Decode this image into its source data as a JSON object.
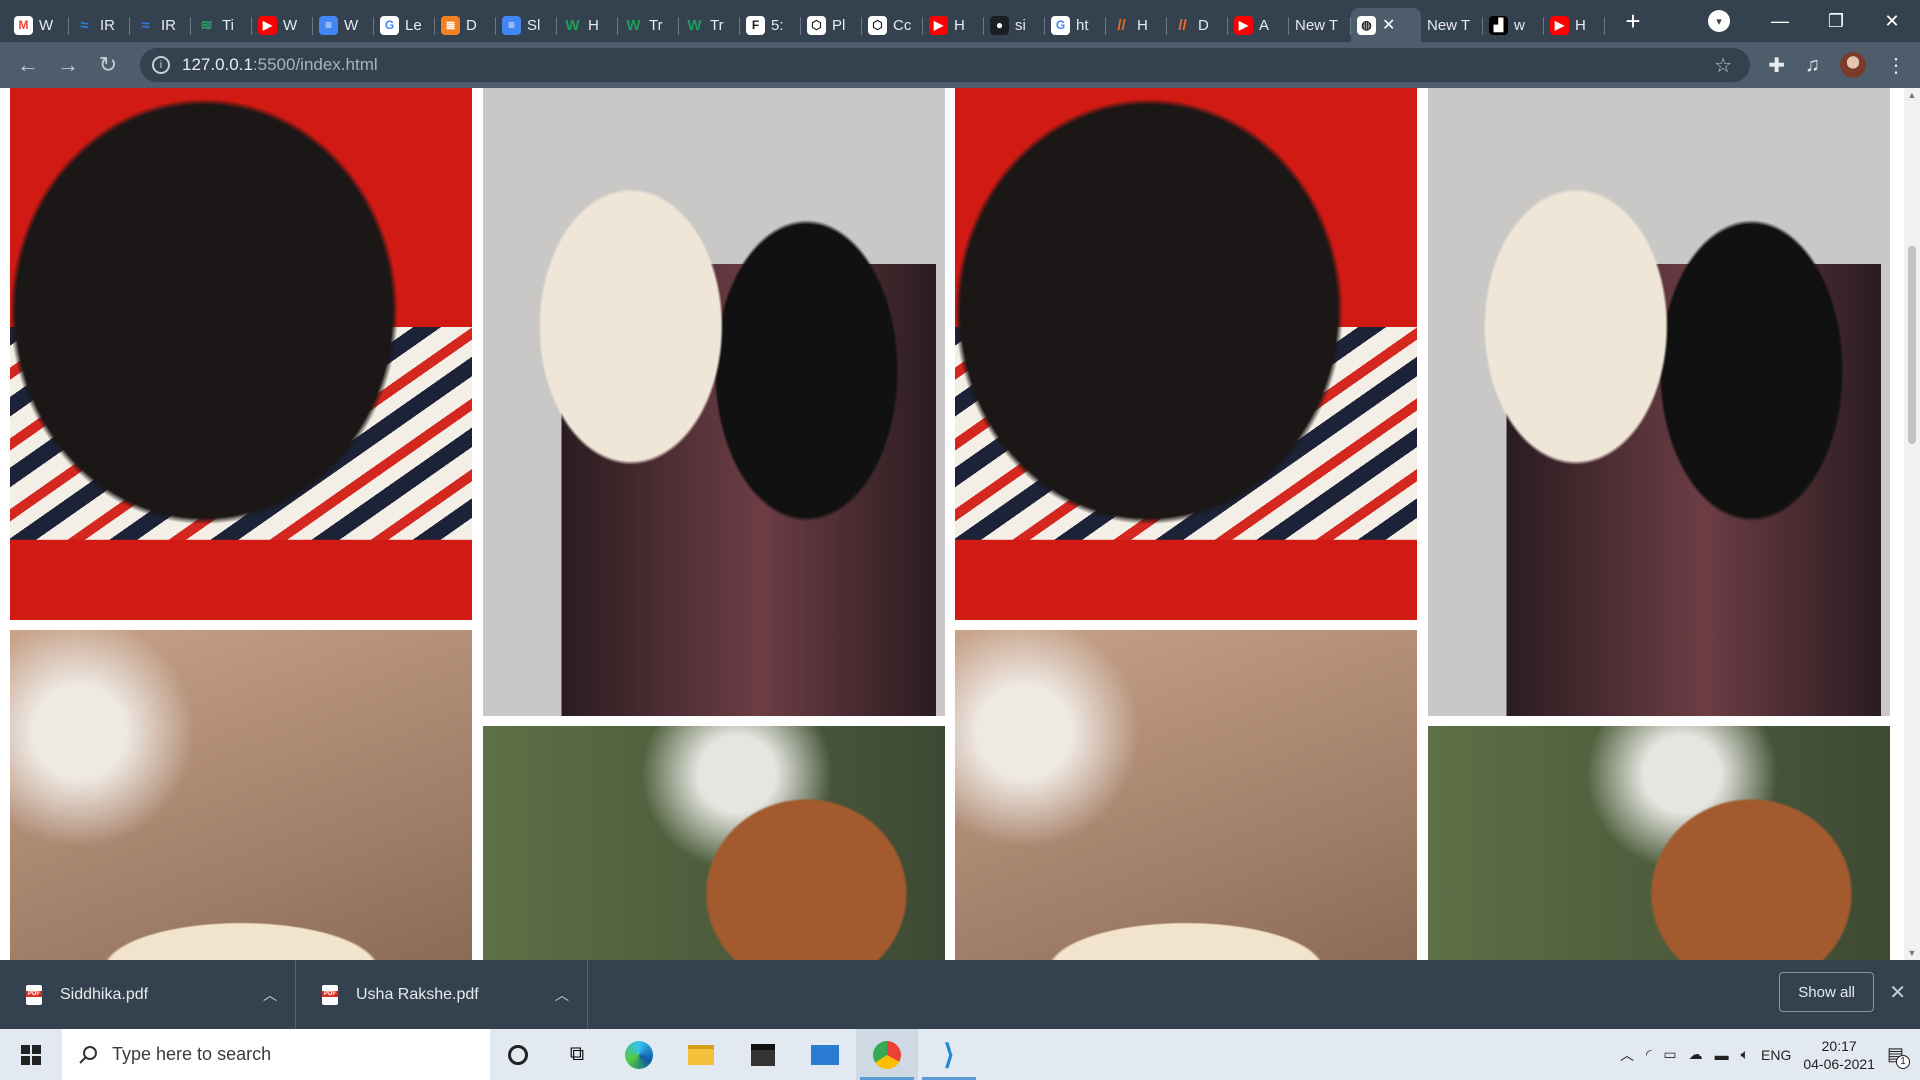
{
  "browser": {
    "tabs": [
      {
        "label": "W",
        "icon": "gmail-icon",
        "color": "#ffffff"
      },
      {
        "label": "IR",
        "icon": "chart-icon",
        "color": "#2a7de1"
      },
      {
        "label": "IR",
        "icon": "chart-icon",
        "color": "#2a7de1"
      },
      {
        "label": "Ti",
        "icon": "wave-icon",
        "color": "#2e9e6a"
      },
      {
        "label": "W",
        "icon": "youtube-icon",
        "color": "#ff0000"
      },
      {
        "label": "W",
        "icon": "docs-icon",
        "color": "#4285f4"
      },
      {
        "label": "Le",
        "icon": "google-icon",
        "color": "#ffffff"
      },
      {
        "label": "D",
        "icon": "stack-icon",
        "color": "#f48024"
      },
      {
        "label": "Sl",
        "icon": "docs-icon",
        "color": "#4285f4"
      },
      {
        "label": "H",
        "icon": "w-icon",
        "color": "#1d9e5b"
      },
      {
        "label": "Tr",
        "icon": "w-icon",
        "color": "#1d9e5b"
      },
      {
        "label": "Tr",
        "icon": "w-icon",
        "color": "#1d9e5b"
      },
      {
        "label": "5:",
        "icon": "f-icon",
        "color": "#ffffff"
      },
      {
        "label": "Pl",
        "icon": "hex-icon",
        "color": "#ffffff"
      },
      {
        "label": "Cc",
        "icon": "hex-icon",
        "color": "#ffffff"
      },
      {
        "label": "H",
        "icon": "youtube-icon",
        "color": "#ff0000"
      },
      {
        "label": "si",
        "icon": "github-icon",
        "color": "#1b1f23"
      },
      {
        "label": "ht",
        "icon": "google-icon",
        "color": "#ffffff"
      },
      {
        "label": "H",
        "icon": "slash-icon",
        "color": "#f26b21"
      },
      {
        "label": "D",
        "icon": "slash-icon",
        "color": "#f26b21"
      },
      {
        "label": "A",
        "icon": "youtube-icon",
        "color": "#ff0000"
      },
      {
        "label": "New T",
        "icon": "",
        "color": ""
      },
      {
        "label": "",
        "icon": "globe-icon",
        "color": "#ffffff",
        "active": true
      },
      {
        "label": "New T",
        "icon": "",
        "color": ""
      },
      {
        "label": "w",
        "icon": "dark-icon",
        "color": "#000000"
      },
      {
        "label": "H",
        "icon": "youtube-icon",
        "color": "#ff0000"
      }
    ],
    "new_tab_glyph": "+",
    "window_controls": {
      "minimize": "—",
      "restore": "❐",
      "close": "✕"
    },
    "url_host": "127.0.0.1",
    "url_rest": ":5500/index.html"
  },
  "downloads": [
    {
      "name": "Siddhika.pdf"
    },
    {
      "name": "Usha Rakshe.pdf"
    }
  ],
  "downloads_show_all": "Show all",
  "taskbar": {
    "search_placeholder": "Type here to search",
    "lang": "ENG",
    "time": "20:17",
    "date": "04-06-2021",
    "notification_count": "1"
  },
  "gallery": [
    {
      "subject": "black pug in striped shirt on red background",
      "colors": [
        "#d11a14",
        "#1a1716"
      ]
    },
    {
      "subject": "white and black dogs sitting on patterned rug",
      "colors": [
        "#c9c8c6",
        "#2a1c20"
      ]
    },
    {
      "subject": "blurred dog under autumn tree",
      "colors": [
        "#c9a38a",
        "#8a6a55"
      ]
    },
    {
      "subject": "brown retriever smiling outdoors",
      "colors": [
        "#5e7046",
        "#a25a2e"
      ]
    }
  ]
}
